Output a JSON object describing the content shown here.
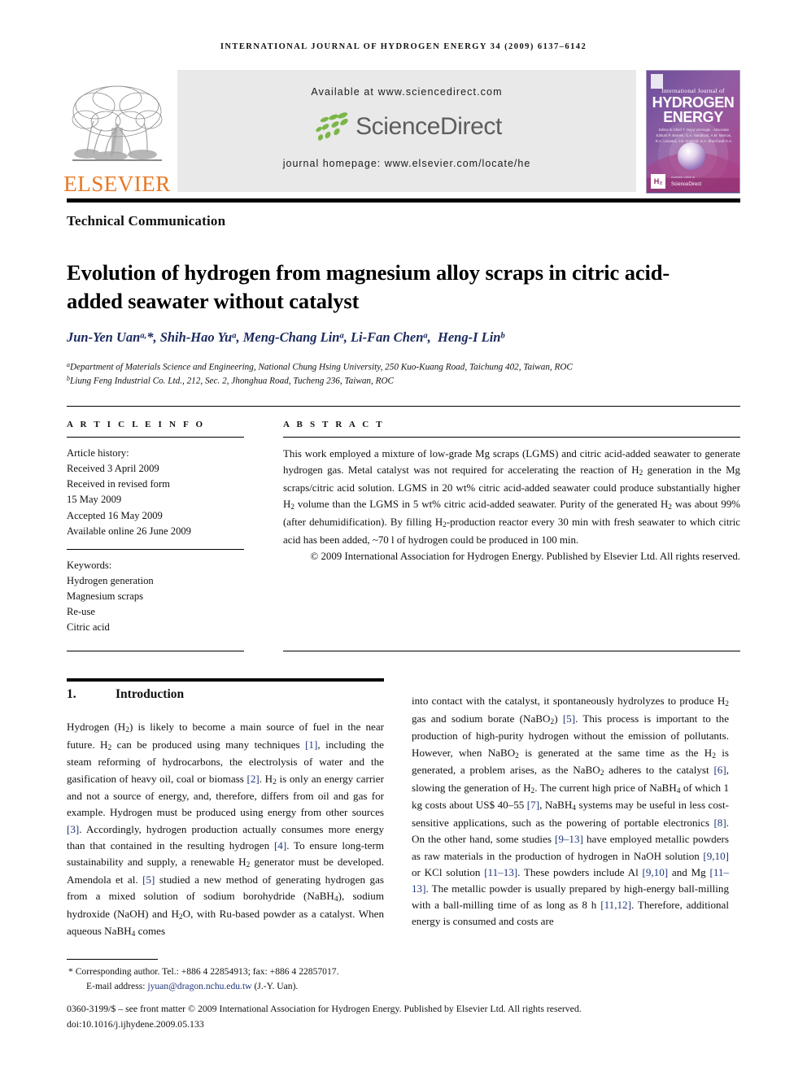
{
  "running_head": "International Journal of Hydrogen Energy 34 (2009) 6137–6142",
  "masthead": {
    "publisher_name": "ELSEVIER",
    "available_at": "Available at www.sciencedirect.com",
    "sciencedirect_word": "ScienceDirect",
    "journal_homepage": "journal homepage: www.elsevier.com/locate/he",
    "cover": {
      "line_small": "International Journal of",
      "line_big_1": "HYDROGEN",
      "line_big_2": "ENERGY",
      "editors": "Editor-in-Chief  T. Nejat Veziroglu   ·   Associate Editors  P. Barnes, G.A. Sandrock, A.M. Marcos, R.A. Lessard, J.N. Armfield, S.A. Sherif and G.A. Varvelli",
      "h2_badge": "H₂",
      "sciencedirect_small": "ScienceDirect",
      "sd_caption": "Available online at"
    }
  },
  "doc_type": "Technical Communication",
  "title": "Evolution of hydrogen from magnesium alloy scraps in citric acid-added seawater without catalyst",
  "authors_html": "Jun-Yen Uan<sup>a,</sup>*, Shih-Hao Yu<sup>a</sup>, Meng-Chang Lin<sup>a</sup>, Li-Fan Chen<sup>a</sup>,&nbsp; Heng-I Lin<sup>b</sup>",
  "affiliations": [
    "Department of Materials Science and Engineering, National Chung Hsing University, 250 Kuo-Kuang Road, Taichung 402, Taiwan, ROC",
    "Liung Feng Industrial Co. Ltd., 212, Sec. 2, Jhonghua Road, Tucheng 236, Taiwan, ROC"
  ],
  "article_info": {
    "label": "A R T I C L E   I N F O",
    "history_label": "Article history:",
    "history": [
      "Received 3 April 2009",
      "Received in revised form",
      "15 May 2009",
      "Accepted 16 May 2009",
      "Available online 26 June 2009"
    ],
    "keywords_label": "Keywords:",
    "keywords": [
      "Hydrogen generation",
      "Magnesium scraps",
      "Re-use",
      "Citric acid"
    ]
  },
  "abstract": {
    "label": "A B S T R A C T",
    "body_html": "This work employed a mixture of low-grade Mg scraps (LGMS) and citric acid-added seawater to generate hydrogen gas. Metal catalyst was not required for accelerating the reaction of H<sub>2</sub> generation in the Mg scraps/citric acid solution. LGMS in 20 wt% citric acid-added seawater could produce substantially higher H<sub>2</sub> volume than the LGMS in 5 wt% citric acid-added seawater. Purity of the generated H<sub>2</sub> was about 99% (after dehumidification). By filling H<sub>2</sub>-production reactor every 30 min with fresh seawater to which citric acid has been added, ~70 l of hydrogen could be produced in 100 min.",
    "copyright": "© 2009 International Association for Hydrogen Energy. Published by Elsevier Ltd. All rights reserved."
  },
  "section": {
    "number": "1.",
    "heading": "Introduction"
  },
  "body": {
    "left_html": "Hydrogen (H<sub>2</sub>) is likely to become a main source of fuel in the near future. H<sub>2</sub> can be produced using many techniques <span class=\"ref\">[1]</span>, including the steam reforming of hydrocarbons, the electrolysis of water and the gasification of heavy oil, coal or biomass <span class=\"ref\">[2]</span>. H<sub>2</sub> is only an energy carrier and not a source of energy, and, therefore, differs from oil and gas for example. Hydrogen must be produced using energy from other sources <span class=\"ref\">[3]</span>. Accordingly, hydrogen production actually consumes more energy than that contained in the resulting hydrogen <span class=\"ref\">[4]</span>. To ensure long-term sustainability and supply, a renewable H<sub>2</sub> generator must be developed. Amendola et al. <span class=\"ref\">[5]</span> studied a new method of generating hydrogen gas from a mixed solution of sodium borohydride (NaBH<sub>4</sub>), sodium hydroxide (NaOH) and H<sub>2</sub>O, with Ru-based powder as a catalyst. When aqueous NaBH<sub>4</sub> comes",
    "right_html": "into contact with the catalyst, it spontaneously hydrolyzes to produce H<sub>2</sub> gas and sodium borate (NaBO<sub>2</sub>) <span class=\"ref\">[5]</span>. This process is important to the production of high-purity hydrogen without the emission of pollutants. However, when NaBO<sub>2</sub> is generated at the same time as the H<sub>2</sub> is generated, a problem arises, as the NaBO<sub>2</sub> adheres to the catalyst <span class=\"ref\">[6]</span>, slowing the generation of H<sub>2</sub>. The current high price of NaBH<sub>4</sub> of which 1 kg costs about US$ 40–55 <span class=\"ref\">[7]</span>, NaBH<sub>4</sub> systems may be useful in less cost-sensitive applications, such as the powering of portable electronics <span class=\"ref\">[8]</span>. On the other hand, some studies <span class=\"ref\">[9–13]</span> have employed metallic powders as raw materials in the production of hydrogen in NaOH solution <span class=\"ref\">[9,10]</span> or KCl solution <span class=\"ref\">[11–13]</span>. These powders include Al <span class=\"ref\">[9,10]</span> and Mg <span class=\"ref\">[11–13]</span>. The metallic powder is usually prepared by high-energy ball-milling with a ball-milling time of as long as 8 h <span class=\"ref\">[11,12]</span>. Therefore, additional energy is consumed and costs are"
  },
  "footnote": {
    "corresponding_html": "* Corresponding author. Tel.: +886 4 22854913; fax: +886 4 22857017.",
    "email_html": "E-mail address: <span class=\"mail\">jyuan@dragon.nchu.edu.tw</span> (J.-Y. Uan).",
    "issn_line": "0360-3199/$ – see front matter © 2009 International Association for Hydrogen Energy. Published by Elsevier Ltd. All rights reserved.",
    "doi_line": "doi:10.1016/j.ijhydene.2009.05.133"
  },
  "colors": {
    "elsevier_orange": "#E87722",
    "sciencedirect_green": "#7AB648",
    "sciencedirect_gray": "#5d5d5d",
    "reference_blue": "#20357a",
    "author_blue": "#1b2a5e",
    "banner_gray": "#e9e9e9"
  }
}
